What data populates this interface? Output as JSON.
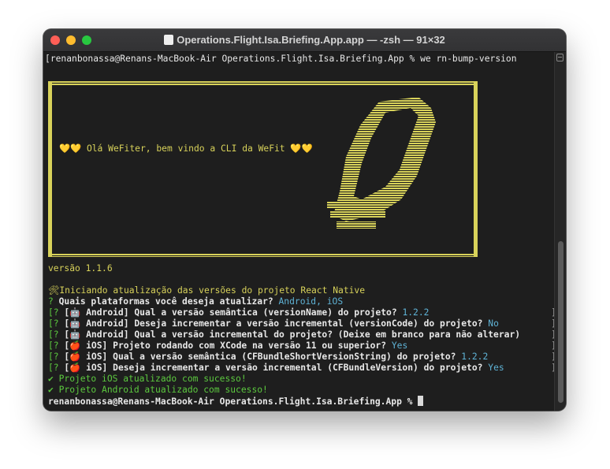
{
  "window": {
    "title": "Operations.Flight.Isa.Briefing.App.app — -zsh — 91×32"
  },
  "terminal": {
    "command_line": "renanbonassa@Renans-MacBook-Air Operations.Flight.Isa.Briefing.App % we rn-bump-version",
    "banner_message": "Olá WeFiter, bem vindo a CLI da WeFit",
    "version_line": "versão 1.1.6",
    "start_line": "Iniciando atualização das versões do projeto React Native",
    "q_platforms": {
      "prefix": "?",
      "question": "Quais plataformas você deseja atualizar?",
      "answer": "Android, iOS"
    },
    "questions": [
      {
        "prefix": "[?",
        "platform": "Android]",
        "question": "Qual a versão semântica (versionName) do projeto?",
        "answer": "1.2.2"
      },
      {
        "prefix": "[?",
        "platform": "Android]",
        "question": "Deseja incrementar a versão incremental (versionCode) do projeto?",
        "answer": "No"
      },
      {
        "prefix": "[?",
        "platform": "Android]",
        "question": "Qual a versão incremental do projeto? (Deixe em branco para não alterar)",
        "answer": ""
      },
      {
        "prefix": "[?",
        "platform": "iOS]",
        "question": "Projeto rodando com XCode na versão 11 ou superior?",
        "answer": "Yes"
      },
      {
        "prefix": "[?",
        "platform": "iOS]",
        "question": "Qual a versão semântica (CFBundleShortVersionString) do projeto?",
        "answer": "1.2.2"
      },
      {
        "prefix": "[?",
        "platform": "iOS]",
        "question": "Deseja incrementar a versão incremental (CFBundleVersion) do projeto?",
        "answer": "Yes"
      }
    ],
    "success_ios": "✔ Projeto iOS atualizado com sucesso!",
    "success_android": "✔ Projeto Android atualizado com sucesso!",
    "prompt": "renanbonassa@Renans-MacBook-Air Operations.Flight.Isa.Briefing.App %"
  },
  "colors": {
    "banner": "#d8d25a",
    "answer": "#5fb3d6",
    "success": "#5cc93f",
    "background": "#1e1e1e"
  },
  "icons": {
    "android": "robot-icon",
    "ios": "apple-icon",
    "tools": "hammer-wrench-icon",
    "heart": "yellow-heart-icon"
  }
}
